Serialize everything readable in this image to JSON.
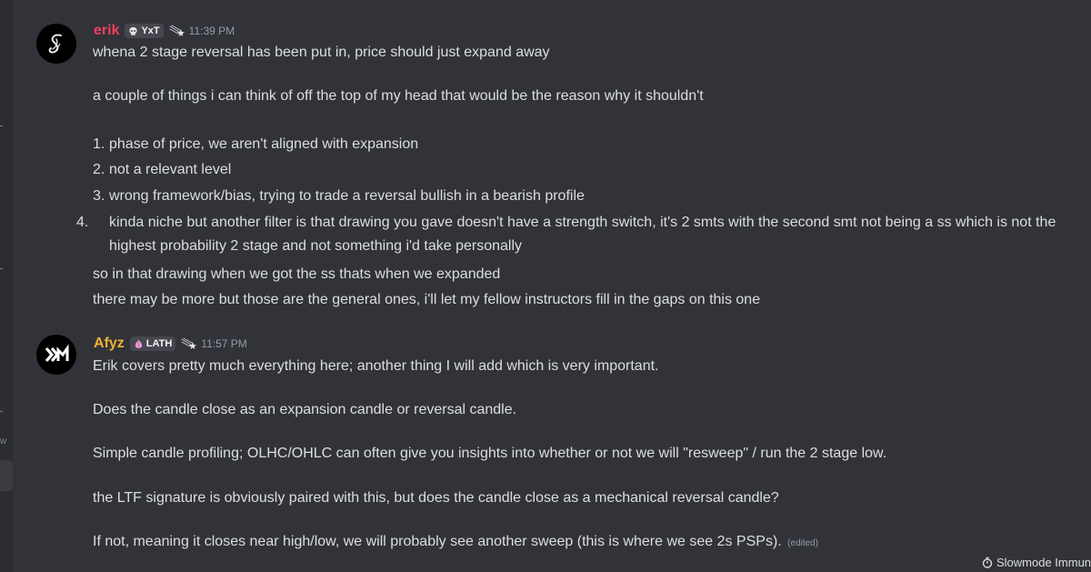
{
  "messages": [
    {
      "author": "erik",
      "author_color": "#f23f5e",
      "tag": "YxT",
      "tag_icon": "skull-icon",
      "badge_icon": "shooting-star-icon",
      "time": "11:39 PM",
      "lines": {
        "l1": "whena  2 stage reversal has been put in, price should just expand away",
        "l2": "a couple of things i can think of off the top of my head that would be the reason why it shouldn't",
        "list": [
          {
            "num": "1.",
            "text": "phase of price, we aren't aligned with expansion"
          },
          {
            "num": "2.",
            "text": "not a relevant level"
          },
          {
            "num": "3.",
            "text": "wrong framework/bias, trying to trade a reversal bullish in a bearish profile"
          },
          {
            "num": "4.",
            "text": "kinda niche but another filter is that drawing you gave doesn't have a strength switch, it's 2 smts with the second smt not being a ss which is not the highest probability 2 stage and not something i'd take personally"
          }
        ],
        "l3": "so in that drawing when we got the ss thats when we expanded",
        "l4": "there may be more but those are the general ones, i'll let my fellow instructors fill in the gaps on this one"
      }
    },
    {
      "author": "Afyz",
      "author_color": "#f0b232",
      "tag": "LATH",
      "tag_icon": "onion-icon",
      "badge_icon": "shooting-star-icon",
      "time": "11:57 PM",
      "lines": {
        "l1": "Erik covers pretty much everything here; another thing I will add which is very important.",
        "l2": "Does the candle close as an expansion candle or reversal candle.",
        "l3": "Simple candle profiling; OLHC/OHLC can often give you insights into whether or not we will \"resweep\" / run the 2 stage low.",
        "l4": "the LTF signature is obviously paired with this, but does the candle close as a mechanical reversal candle?",
        "l5": "If not, meaning it closes near high/low, we will probably see another sweep (this is where we see 2s PSPs).",
        "edited": "(edited)"
      }
    }
  ],
  "sidebar": {
    "letter": "w"
  },
  "footer": {
    "slowmode": "Slowmode Immune"
  }
}
